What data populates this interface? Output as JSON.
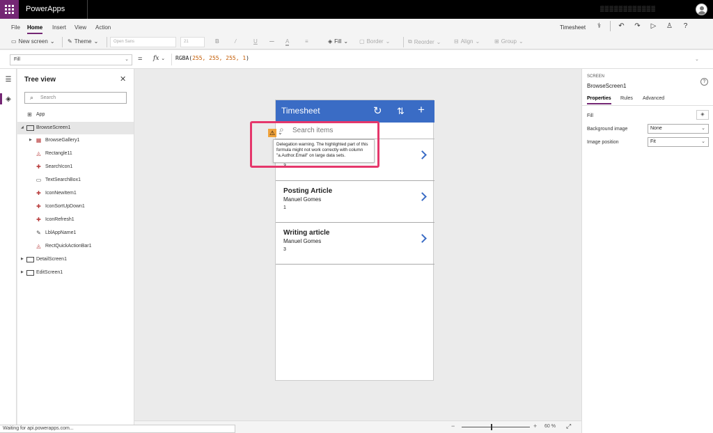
{
  "appbar": {
    "app_name": "PowerApps",
    "user_name": "▒▒▒▒▒▒▒▒▒▒▒▒"
  },
  "ribbon": {
    "tabs": [
      {
        "label": "File"
      },
      {
        "label": "Home"
      },
      {
        "label": "Insert"
      },
      {
        "label": "View"
      },
      {
        "label": "Action"
      }
    ],
    "screen_title": "Timesheet",
    "new_screen": "New screen",
    "theme": "Theme",
    "font": "Open Sans",
    "font_size": "21",
    "bold": "B",
    "italic": "/",
    "underline": "U",
    "font_color": "A",
    "fill": "Fill",
    "border": "Border",
    "reorder": "Reorder",
    "align": "Align",
    "group": "Group"
  },
  "formulabar": {
    "property": "Fill",
    "equals": "=",
    "fx": "fx",
    "formula_prefix": "RGBA(",
    "formula_args": "255, 255, 255, 1",
    "formula_suffix": ")"
  },
  "treeview": {
    "title": "Tree view",
    "search_placeholder": "Search",
    "items": [
      {
        "label": "App"
      },
      {
        "label": "BrowseScreen1"
      },
      {
        "label": "BrowseGallery1"
      },
      {
        "label": "Rectangle11"
      },
      {
        "label": "SearchIcon1"
      },
      {
        "label": "TextSearchBox1"
      },
      {
        "label": "IconNewItem1"
      },
      {
        "label": "IconSortUpDown1"
      },
      {
        "label": "IconRefresh1"
      },
      {
        "label": "LblAppName1"
      },
      {
        "label": "RectQuickActionBar1"
      },
      {
        "label": "DetailScreen1"
      },
      {
        "label": "EditScreen1"
      }
    ]
  },
  "phone": {
    "title": "Timesheet",
    "search_placeholder": "Search items",
    "items": [
      {
        "title": "",
        "author": "",
        "count": "3"
      },
      {
        "title": "Posting Article",
        "author": "Manuel Gomes",
        "count": "1"
      },
      {
        "title": "Writing article",
        "author": "Manuel Gomes",
        "count": "3"
      }
    ],
    "header_color": "#3a6cc5"
  },
  "warning": {
    "tooltip": "Delegation warning. The highlighted part of this formula might not work correctly with column \"a.Author.Email\" on large data sets.",
    "highlight_color": "#e5376b"
  },
  "canvas": {
    "zoom": "60 %",
    "status": "Waiting for api.powerapps.com..."
  },
  "properties_panel": {
    "kind": "SCREEN",
    "name": "BrowseScreen1",
    "tabs": [
      {
        "label": "Properties"
      },
      {
        "label": "Rules"
      },
      {
        "label": "Advanced"
      }
    ],
    "fill_label": "Fill",
    "background_image_label": "Background image",
    "background_image_value": "None",
    "image_position_label": "Image position",
    "image_position_value": "Fit"
  },
  "accent_color": "#742774"
}
